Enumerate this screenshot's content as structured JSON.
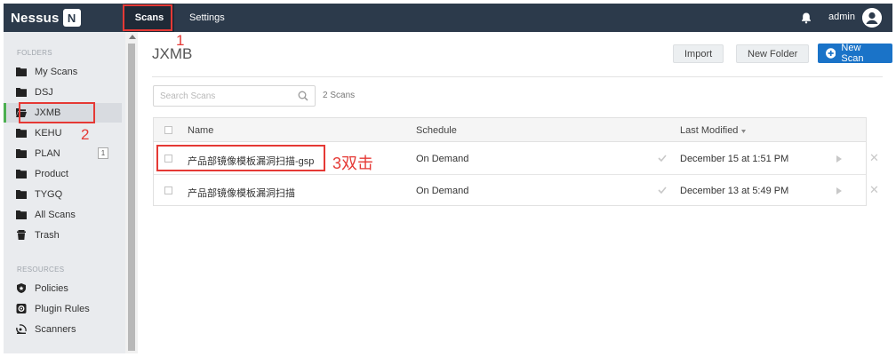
{
  "topbar": {
    "logo_text": "Nessus",
    "logo_badge": "N",
    "tabs": [
      {
        "label": "Scans",
        "active": true
      },
      {
        "label": "Settings",
        "active": false
      }
    ],
    "user": "admin",
    "bell_icon": "bell-icon",
    "avatar_icon": "user-avatar-icon"
  },
  "sidebar": {
    "folders_header": "FOLDERS",
    "folders": [
      {
        "label": "My Scans",
        "icon": "folder-icon"
      },
      {
        "label": "DSJ",
        "icon": "folder-icon"
      },
      {
        "label": "JXMB",
        "icon": "folder-open-icon",
        "active": true
      },
      {
        "label": "KEHU",
        "icon": "folder-icon"
      },
      {
        "label": "PLAN",
        "icon": "folder-icon",
        "badge": "1"
      },
      {
        "label": "Product",
        "icon": "folder-icon"
      },
      {
        "label": "TYGQ",
        "icon": "folder-icon"
      },
      {
        "label": "All Scans",
        "icon": "folder-icon"
      },
      {
        "label": "Trash",
        "icon": "trash-icon"
      }
    ],
    "resources_header": "RESOURCES",
    "resources": [
      {
        "label": "Policies",
        "icon": "shield-icon"
      },
      {
        "label": "Plugin Rules",
        "icon": "plugin-icon"
      },
      {
        "label": "Scanners",
        "icon": "satellite-icon"
      }
    ]
  },
  "main": {
    "title": "JXMB",
    "buttons": {
      "import": "Import",
      "new_folder": "New Folder",
      "new_scan": "New Scan"
    },
    "search_placeholder": "Search Scans",
    "scan_count": "2 Scans",
    "columns": {
      "name": "Name",
      "schedule": "Schedule",
      "last_modified": "Last Modified"
    },
    "rows": [
      {
        "name": "产品部镜像模板漏洞扫描-gsp",
        "schedule": "On Demand",
        "last_modified": "December 15 at 1:51 PM"
      },
      {
        "name": "产品部镜像模板漏洞扫描",
        "schedule": "On Demand",
        "last_modified": "December 13 at 5:49 PM"
      }
    ]
  },
  "annotations": {
    "step1": "1",
    "step2": "2",
    "step3": "3双击",
    "color": "#e53935"
  },
  "colors": {
    "topbar": "#2c3a4b",
    "accent_blue": "#1a73c8",
    "active_marker": "#4caf50"
  }
}
